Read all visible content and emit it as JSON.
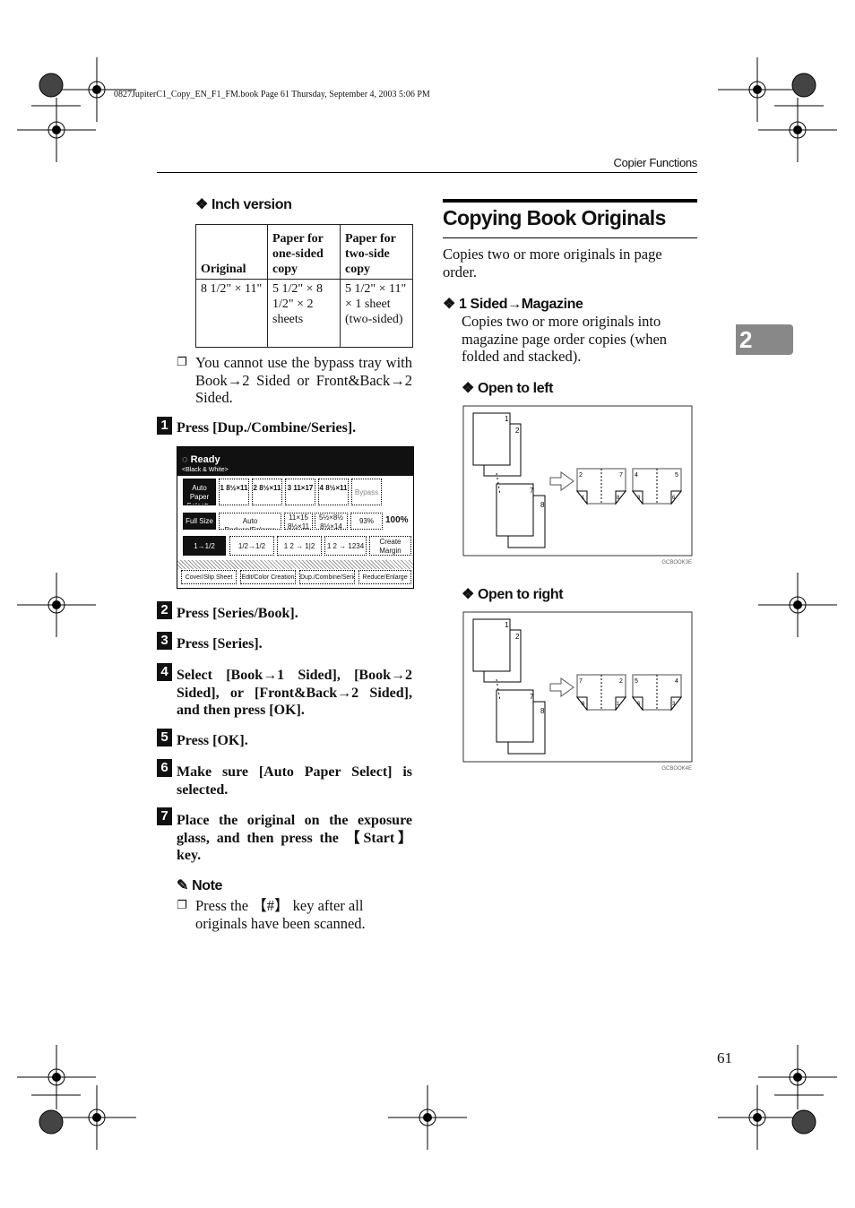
{
  "print_header": "0827JupiterC1_Copy_EN_F1_FM.book  Page 61  Thursday, September 4, 2003  5:06 PM",
  "running_header": "Copier Functions",
  "chapter_tab": "2",
  "page_number": "61",
  "left": {
    "inch_version_heading": "Inch version",
    "table": {
      "headers": [
        "Original",
        "Paper for one-sided copy",
        "Paper for two-side copy"
      ],
      "row": [
        "8 1/2\" × 11\"",
        "5 1/2\" × 8 1/2\" × 2 sheets",
        "5 1/2\" × 11\" × 1 sheet (two-sided)"
      ]
    },
    "table_note": "You cannot use the bypass tray with Book→2 Sided or Front&Back→2 Sided.",
    "steps": [
      {
        "marker": "1",
        "text": "Press [Dup./Combine/Series]."
      },
      {
        "marker": "2",
        "text": "Press [Series/Book]."
      },
      {
        "marker": "3",
        "text": "Press [Series]."
      },
      {
        "marker": "4",
        "text": "Select [Book→1 Sided], [Book→2 Sided], or [Front&Back→2 Sided], and then press [OK]."
      },
      {
        "marker": "5",
        "text": "Press [OK]."
      },
      {
        "marker": "6",
        "text": "Make sure [Auto Paper Select] is selected."
      },
      {
        "marker": "7",
        "text": "Place the original on the exposure glass, and then press the 【Start】 key."
      }
    ],
    "note_heading": "Note",
    "note_text": "Press the 【#】 key after all originals have been scanned.",
    "panel": {
      "status": "Ready",
      "mode": "<Black & White>",
      "paper_buttons": [
        "Auto Paper Select▶",
        "1 8½×11",
        "2 8½×11",
        "3 11×17",
        "4 8½×11",
        "Bypass"
      ],
      "ratio_buttons": [
        "Full Size",
        "Auto Reduce/Enlarge",
        "11×15 8½×11",
        "5½×8½ 8½×14",
        "93%"
      ],
      "ratio_value": "100%",
      "function_buttons": [
        "1→1/2",
        "1/2→1/2",
        "1 2 → 1|2",
        "1 2 → 1234",
        "Create Margin"
      ],
      "tabs": [
        "Cover/Slip Sheet",
        "Edit/Color Creation",
        "Dup./Combine/Series",
        "Reduce/Enlarge"
      ]
    }
  },
  "right": {
    "title": "Copying Book Originals",
    "intro": "Copies two or more originals in page order.",
    "magazine_heading": "1 Sided→Magazine",
    "magazine_text": "Copies two or more originals into magazine page order copies (when folded and stacked).",
    "open_left_heading": "Open to left",
    "open_right_heading": "Open to right",
    "figures": [
      {
        "code": "GCBOOK3E",
        "originals": [
          "1",
          "2",
          "7",
          "8"
        ],
        "booklets": [
          [
            "2",
            "7",
            "1",
            "8"
          ],
          [
            "4",
            "5",
            "3",
            "6"
          ]
        ]
      },
      {
        "code": "GCBOOK4E",
        "originals": [
          "1",
          "2",
          "7",
          "8"
        ],
        "booklets": [
          [
            "7",
            "2",
            "8",
            "1"
          ],
          [
            "5",
            "4",
            "6",
            "3"
          ]
        ]
      }
    ]
  }
}
